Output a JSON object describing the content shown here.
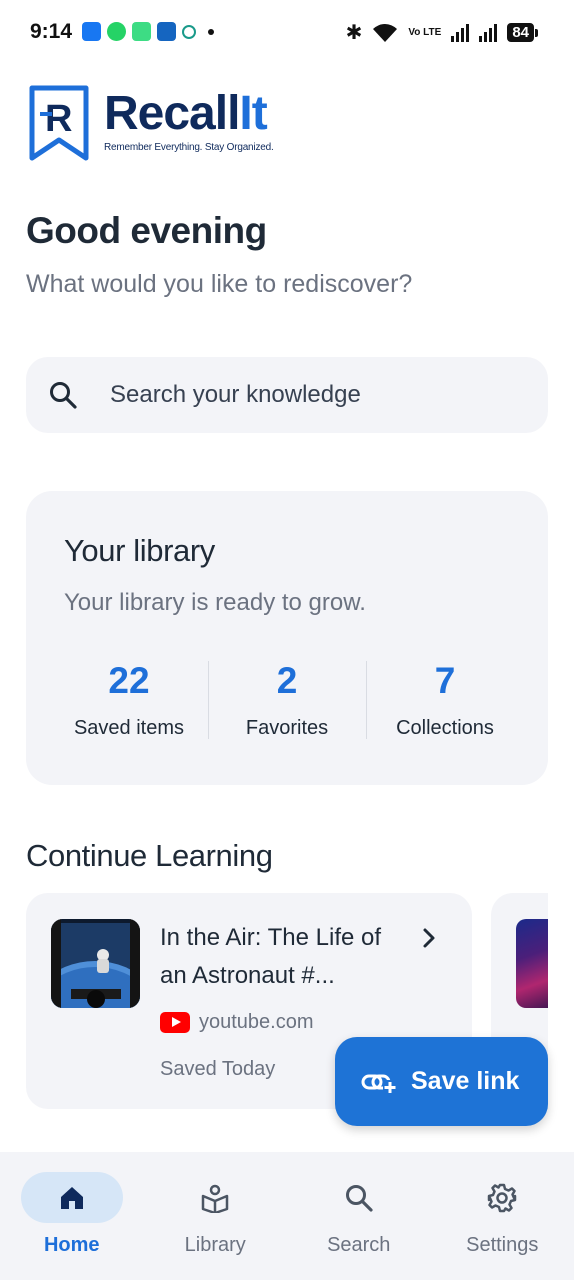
{
  "status_bar": {
    "time": "9:14",
    "battery": "84",
    "network_label": "Vo LTE"
  },
  "brand": {
    "name_main": "Recall",
    "name_accent": "It",
    "tagline": "Remember Everything. Stay Organized.",
    "colors": {
      "navy": "#0f2a5c",
      "blue": "#1e6fd9"
    }
  },
  "greeting": {
    "title": "Good evening",
    "subtitle": "What would you like to rediscover?"
  },
  "search": {
    "placeholder": "Search your knowledge",
    "icon": "search-icon"
  },
  "library": {
    "title": "Your library",
    "subtitle": "Your library is ready to grow.",
    "stats": [
      {
        "value": "22",
        "label": "Saved items"
      },
      {
        "value": "2",
        "label": "Favorites"
      },
      {
        "value": "7",
        "label": "Collections"
      }
    ]
  },
  "continue_learning": {
    "title": "Continue Learning",
    "items": [
      {
        "title": "In the Air: The Life of an Astronaut  #...",
        "source": "youtube.com",
        "source_icon": "youtube-icon",
        "saved": "Saved Today"
      }
    ]
  },
  "fab": {
    "label": "Save link",
    "icon": "add-link-icon"
  },
  "bottom_nav": {
    "items": [
      {
        "label": "Home",
        "icon": "home-icon",
        "active": true
      },
      {
        "label": "Library",
        "icon": "library-icon",
        "active": false
      },
      {
        "label": "Search",
        "icon": "search-icon",
        "active": false
      },
      {
        "label": "Settings",
        "icon": "gear-icon",
        "active": false
      }
    ]
  },
  "accent_color": "#1e73d6"
}
